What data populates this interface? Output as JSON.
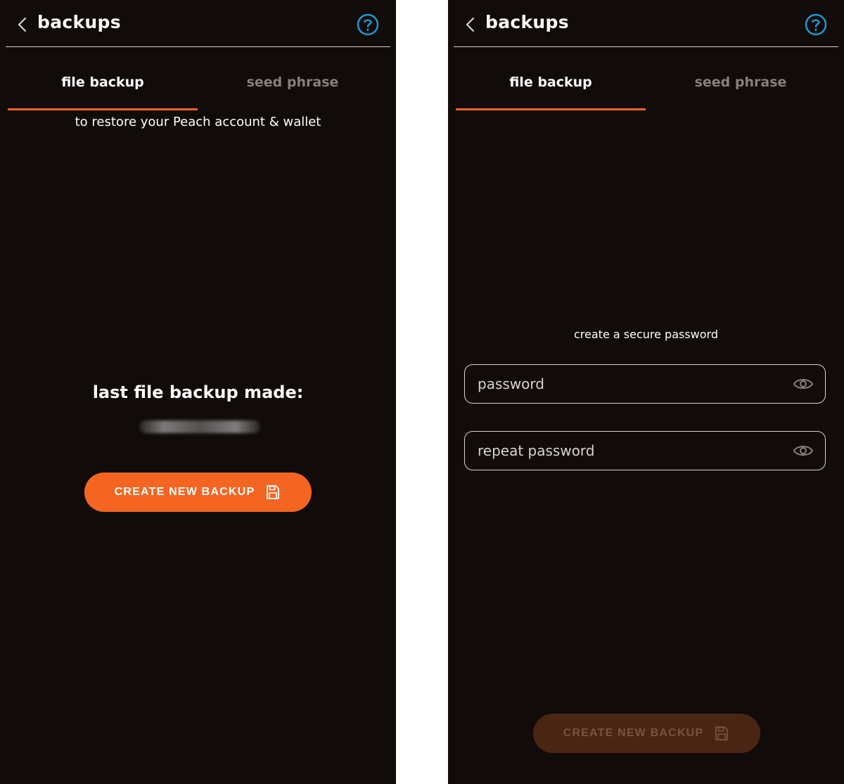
{
  "left_screen": {
    "header": {
      "title": "backups",
      "back_icon": "chevron-left-icon",
      "help_icon": "question-circle-icon"
    },
    "tabs": [
      {
        "label": "file backup",
        "active": true
      },
      {
        "label": "seed phrase",
        "active": false
      }
    ],
    "subtitle": "to restore your Peach account & wallet",
    "last_backup_label": "last file backup made:",
    "button": {
      "label": "CREATE NEW BACKUP",
      "icon": "floppy-disk-icon"
    }
  },
  "right_screen": {
    "header": {
      "title": "backups",
      "back_icon": "chevron-left-icon",
      "help_icon": "question-circle-icon"
    },
    "tabs": [
      {
        "label": "file backup",
        "active": true
      },
      {
        "label": "seed phrase",
        "active": false
      }
    ],
    "prompt": "create a secure password",
    "password_field": {
      "placeholder": "password",
      "value": "",
      "icon": "eye-icon"
    },
    "repeat_password_field": {
      "placeholder": "repeat password",
      "value": "",
      "icon": "eye-icon"
    },
    "button": {
      "label": "CREATE NEW BACKUP",
      "icon": "floppy-disk-icon",
      "disabled": true
    }
  },
  "colors": {
    "background": "#110b09",
    "accent": "#f56522",
    "accent_disabled": "#4a2514",
    "help_icon": "#1e9bd8",
    "inactive_tab": "#8a7f78",
    "divider": "#d9d4d0"
  }
}
